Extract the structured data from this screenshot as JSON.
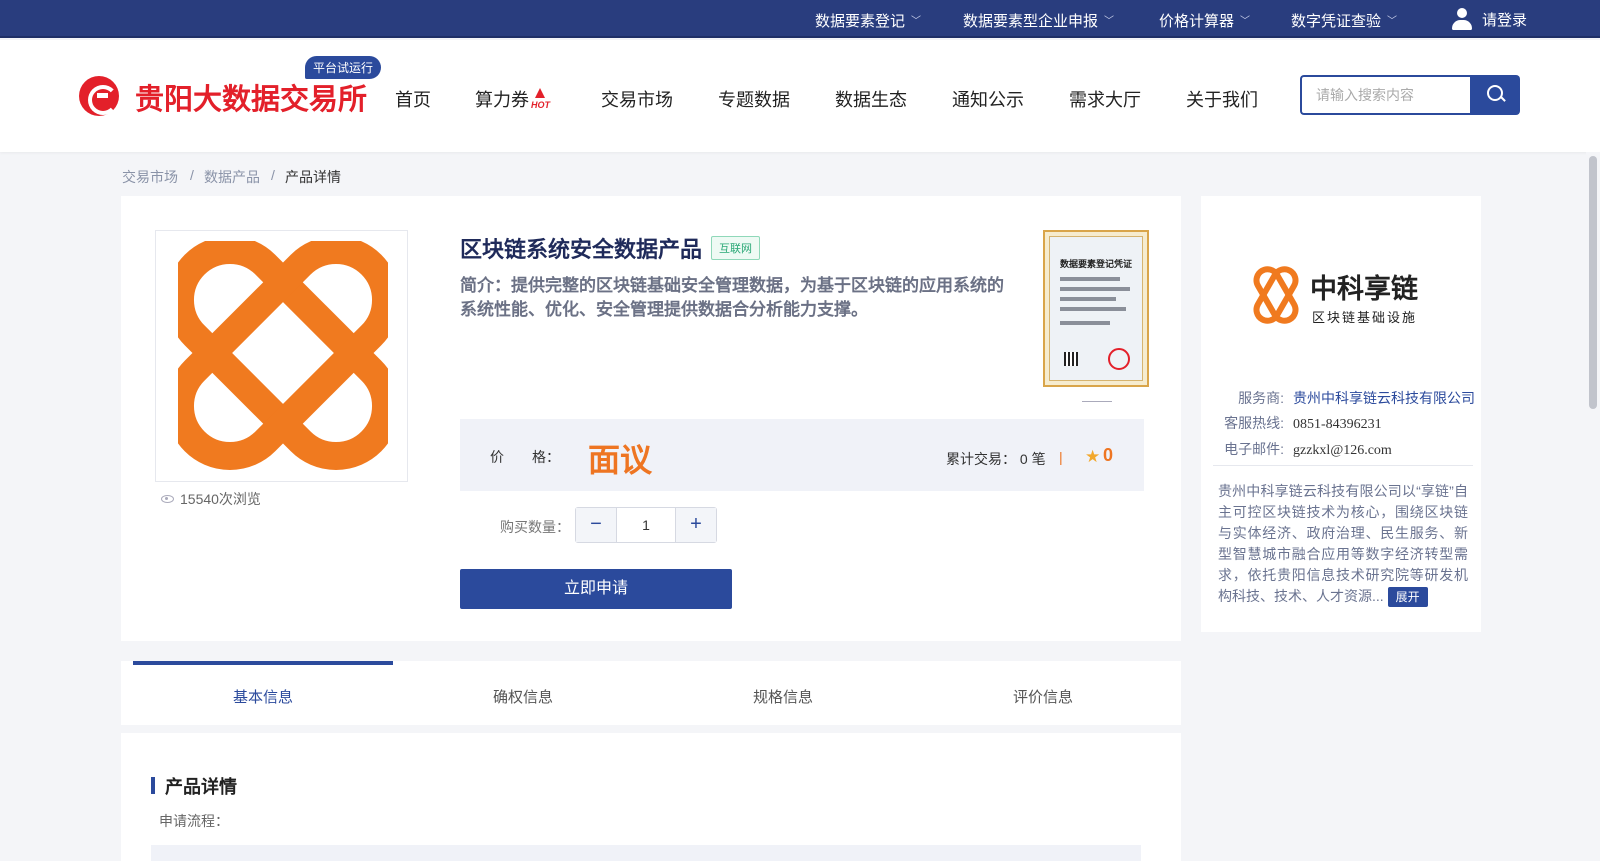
{
  "topbar": {
    "links": [
      {
        "label": "数据要素登记"
      },
      {
        "label": "数据要素型企业申报"
      },
      {
        "label": "价格计算器"
      },
      {
        "label": "数字凭证查验"
      }
    ],
    "login_label": "请登录"
  },
  "header": {
    "logo_text": "贵阳大数据交易所",
    "trial_badge": "平台试运行",
    "nav": [
      "首页",
      "算力券",
      "交易市场",
      "专题数据",
      "数据生态",
      "通知公示",
      "需求大厅",
      "关于我们"
    ],
    "hot_label": "HOT",
    "search_placeholder": "请输入搜索内容"
  },
  "breadcrumb": {
    "items": [
      "交易市场",
      "数据产品",
      "产品详情"
    ],
    "separator": "/"
  },
  "product": {
    "title": "区块链系统安全数据产品",
    "tag": "互联网",
    "description": "简介：提供完整的区块链基础安全管理数据，为基于区块链的应用系统的系统性能、优化、安全管理提供数据合分析能力支撑。",
    "views": "15540次浏览",
    "certificate_title": "数据要素登记凭证",
    "price_label": "价　　格：",
    "price_value": "面议",
    "transactions_label": "累计交易：",
    "transactions_value": "0 笔",
    "rating_separator": "|",
    "rating_value": "0",
    "quantity_label": "购买数量：",
    "quantity_value": "1",
    "minus_label": "−",
    "plus_label": "+",
    "apply_label": "立即申请"
  },
  "vendor": {
    "logo_name": "中科享链",
    "logo_sub": "区块链基础设施",
    "provider_label": "服务商:",
    "provider_value": "贵州中科享链云科技有限公司",
    "hotline_label": "客服热线:",
    "hotline_value": "0851-84396231",
    "email_label": "电子邮件:",
    "email_value": "gzzkxl@126.com",
    "description": "贵州中科享链云科技有限公司以“享链”自主可控区块链技术为核心，围绕区块链与实体经济、政府治理、民生服务、新型智慧城市融合应用等数字经济转型需求，依托贵阳信息技术研究院等研发机构科技、技术、人才资源...",
    "expand_label": "展开"
  },
  "tabs": [
    "基本信息",
    "确权信息",
    "规格信息",
    "评价信息"
  ],
  "details": {
    "title": "产品详情",
    "subtitle": "申请流程："
  },
  "colors": {
    "brand_blue": "#2b4a9c",
    "topbar": "#293d7e",
    "logo_red": "#e3202a",
    "accent_orange": "#ee7522"
  }
}
